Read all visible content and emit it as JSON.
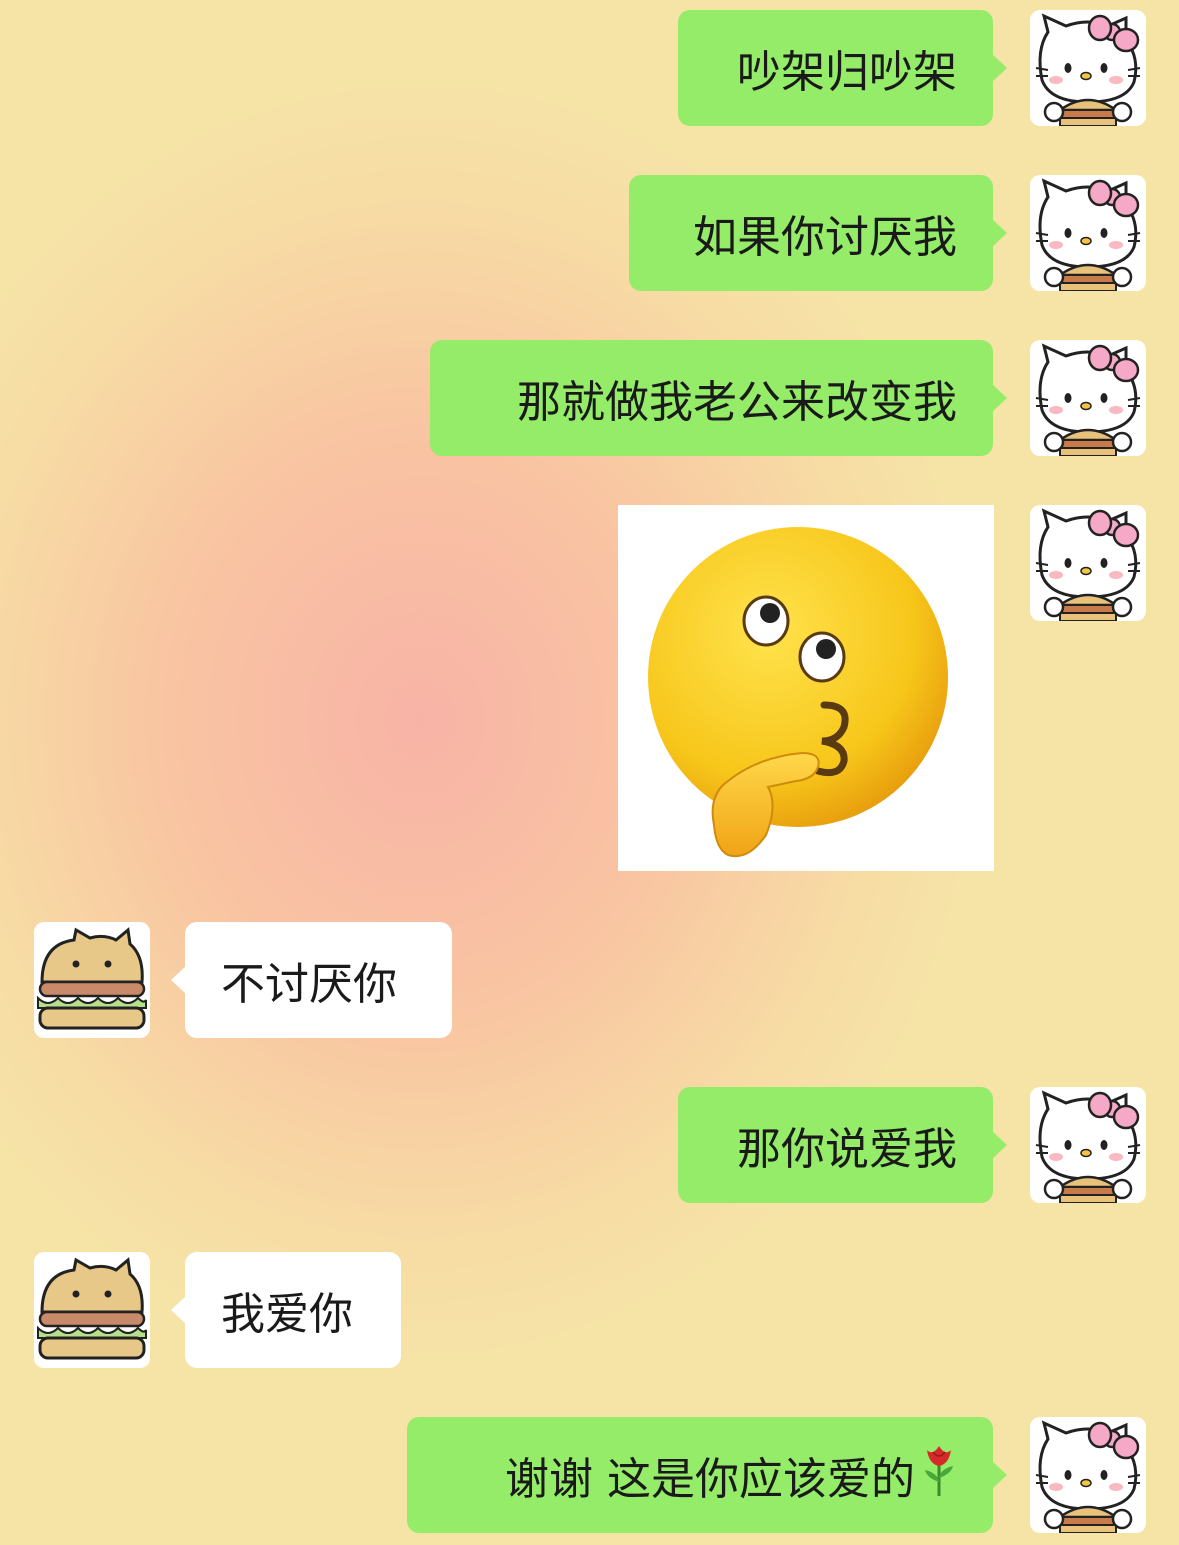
{
  "messages": [
    {
      "side": "out",
      "text": "吵架归吵架"
    },
    {
      "side": "out",
      "text": "如果你讨厌我"
    },
    {
      "side": "out",
      "text": "那就做我老公来改变我"
    },
    {
      "side": "out",
      "type": "sticker",
      "sticker": "thinking-kiss-emoji"
    },
    {
      "side": "in",
      "text": "不讨厌你"
    },
    {
      "side": "out",
      "text": "那你说爱我"
    },
    {
      "side": "in",
      "text": "我爱你"
    },
    {
      "side": "out",
      "text": "谢谢 这是你应该爱的",
      "emoji": "rose-emoji"
    }
  ],
  "avatars": {
    "self": "hello-kitty-avatar-icon",
    "other": "burger-bear-avatar-icon"
  },
  "colors": {
    "outgoing_bubble": "#95ec69",
    "incoming_bubble": "#ffffff",
    "sticker_face": "#f7c61a"
  }
}
